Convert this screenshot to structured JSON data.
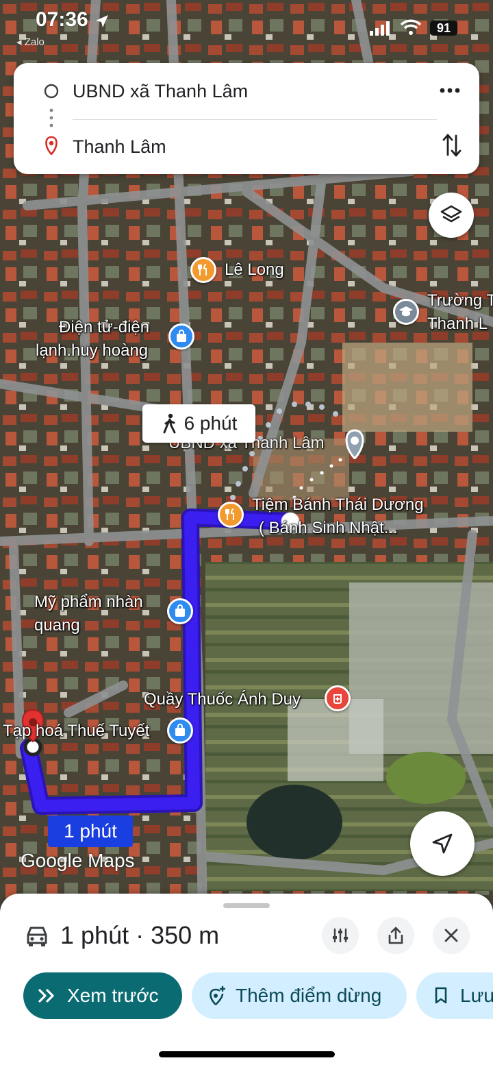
{
  "status_bar": {
    "time": "07:36",
    "back_app": "◂ Zalo",
    "battery": "91"
  },
  "directions": {
    "origin": "UBND xã Thanh Lâm",
    "destination": "Thanh Lâm",
    "more_icon": "more-vert-icon",
    "swap_icon": "swap-icon"
  },
  "map": {
    "pois": [
      {
        "name": "Lê Long",
        "type": "restaurant"
      },
      {
        "name": "Trường T",
        "name2": "Thanh L",
        "type": "school"
      },
      {
        "name": "Điện tử-điện",
        "name2": "lạnh.huy hoàng",
        "type": "shopping"
      },
      {
        "name": "UBND xã Thanh Lâm",
        "type": "landmark"
      },
      {
        "name": "Tiệm Bánh Thái Dương",
        "name2": "( Bánh Sinh Nhật...",
        "type": "restaurant"
      },
      {
        "name": "Mỹ phẩm nhàn",
        "name2": "quang",
        "type": "shopping"
      },
      {
        "name": "Quầy Thuốc Ánh Duy",
        "type": "pharmacy"
      },
      {
        "name": "Tạp hoá Thuế Tuyết",
        "type": "shopping"
      }
    ],
    "walk_time": "6 phút",
    "drive_time": "1 phút",
    "watermark": "Google Maps",
    "colors": {
      "route": "#3b1ef0",
      "restaurant": "#f29a2e",
      "shopping": "#2f8bf0",
      "pharmacy": "#e8453c",
      "school": "#7a8a99"
    }
  },
  "sheet": {
    "summary": "1 phút · 350 m",
    "chips": {
      "preview": "Xem trước",
      "add_stop": "Thêm điểm dừng",
      "save": "Lưu"
    },
    "accent": "#0b6b73",
    "chip_bg": "#d3efff"
  }
}
